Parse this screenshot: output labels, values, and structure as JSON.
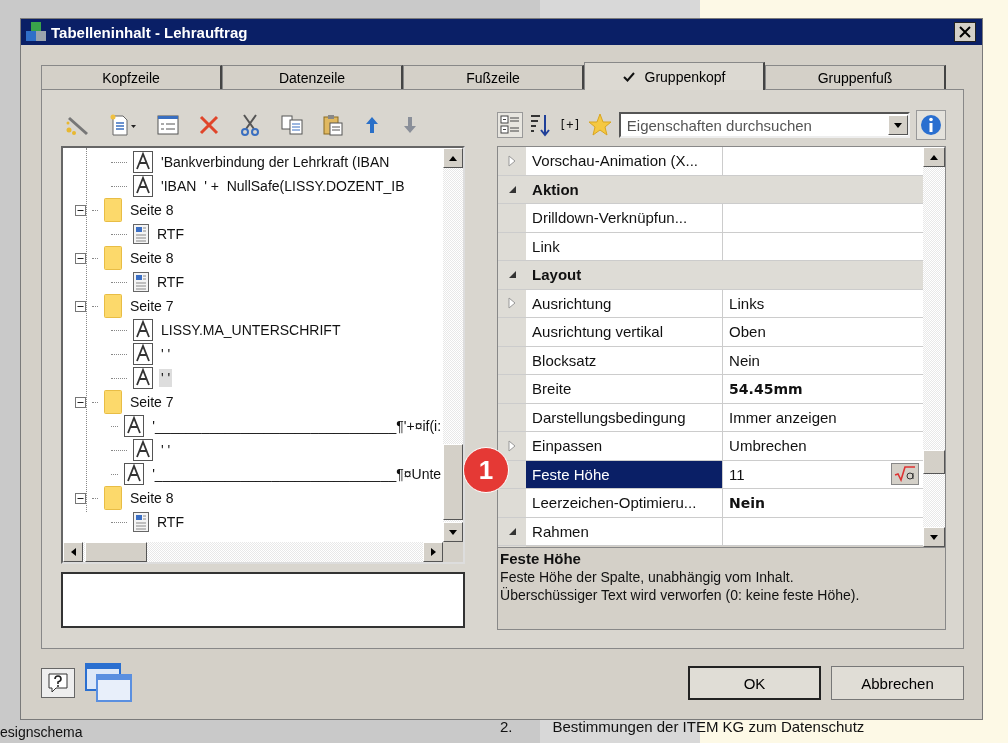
{
  "window": {
    "title": "Tabelleninhalt - Lehrauftrag"
  },
  "tabs": [
    {
      "label": "Kopfzeile",
      "selected": false,
      "checked": false
    },
    {
      "label": "Datenzeile",
      "selected": false,
      "checked": false
    },
    {
      "label": "Fußzeile",
      "selected": false,
      "checked": false
    },
    {
      "label": "Gruppenkopf",
      "selected": true,
      "checked": true
    },
    {
      "label": "Gruppenfuß",
      "selected": false,
      "checked": false
    }
  ],
  "tree": {
    "continued_children": [
      {
        "kind": "text",
        "label": "'Bankverbindung der Lehrkraft (IBAN",
        "selected": false
      },
      {
        "kind": "text",
        "label": "'IBAN  ' +  NullSafe(LISSY.DOZENT_IB",
        "selected": false
      }
    ],
    "nodes": [
      {
        "kind": "folder",
        "label": "Seite 8",
        "expanded": true,
        "children": [
          {
            "kind": "rtf",
            "label": "RTF",
            "selected": false
          }
        ]
      },
      {
        "kind": "folder",
        "label": "Seite 8",
        "expanded": true,
        "children": [
          {
            "kind": "rtf",
            "label": "RTF",
            "selected": false
          }
        ]
      },
      {
        "kind": "folder",
        "label": "Seite 7",
        "expanded": true,
        "children": [
          {
            "kind": "text",
            "label": "LISSY.MA_UNTERSCHRIFT",
            "selected": false
          },
          {
            "kind": "text",
            "label": "' '",
            "selected": false
          },
          {
            "kind": "text",
            "label": "' '",
            "selected": true
          }
        ]
      },
      {
        "kind": "folder",
        "label": "Seite 7",
        "expanded": true,
        "children": [
          {
            "kind": "text",
            "label": "'_______________________________¶'+¤if(i:",
            "selected": false
          },
          {
            "kind": "text",
            "label": "' '",
            "selected": false
          },
          {
            "kind": "text",
            "label": "'_______________________________¶¤Unte",
            "selected": false
          }
        ]
      },
      {
        "kind": "folder",
        "label": "Seite 8",
        "expanded": true,
        "children": [
          {
            "kind": "rtf",
            "label": "RTF",
            "selected": false
          }
        ]
      }
    ]
  },
  "property_toolbar": {
    "expand_all": "[+]",
    "search": {
      "placeholder": "Eigenschaften durchsuchen"
    }
  },
  "properties": [
    {
      "kind": "property",
      "name": "Vorschau-Animation (X...",
      "has_children": true,
      "expanded": false,
      "selected": false,
      "formula_button": false
    },
    {
      "kind": "category",
      "name": "Aktion",
      "expanded": true
    },
    {
      "kind": "property",
      "name": "Drilldown-Verknüpfun...",
      "has_children": false,
      "selected": false,
      "formula_button": false
    },
    {
      "kind": "property",
      "name": "Link",
      "has_children": false,
      "selected": false,
      "formula_button": false
    },
    {
      "kind": "category",
      "name": "Layout",
      "expanded": true
    },
    {
      "kind": "property",
      "name": "Ausrichtung",
      "value": "Links",
      "has_children": true,
      "expanded": false,
      "selected": false,
      "bold": false,
      "formula_button": false
    },
    {
      "kind": "property",
      "name": "Ausrichtung vertikal",
      "value": "Oben",
      "has_children": false,
      "selected": false,
      "bold": false,
      "formula_button": false
    },
    {
      "kind": "property",
      "name": "Blocksatz",
      "value": "Nein",
      "has_children": false,
      "selected": false,
      "bold": false,
      "formula_button": false
    },
    {
      "kind": "property",
      "name": "Breite",
      "value": "54.45mm",
      "has_children": false,
      "selected": false,
      "bold": true,
      "formula_button": false
    },
    {
      "kind": "property",
      "name": "Darstellungsbedingung",
      "value": "Immer anzeigen",
      "has_children": false,
      "selected": false,
      "bold": false,
      "formula_button": false
    },
    {
      "kind": "property",
      "name": "Einpassen",
      "value": "Umbrechen",
      "has_children": true,
      "expanded": false,
      "selected": false,
      "bold": false,
      "formula_button": false
    },
    {
      "kind": "property",
      "name": "Feste Höhe",
      "value": "11",
      "has_children": false,
      "selected": true,
      "bold": false,
      "formula_button": true
    },
    {
      "kind": "property",
      "name": "Leerzeichen-Optimieru...",
      "value": "Nein",
      "has_children": false,
      "selected": false,
      "bold": true,
      "formula_button": false
    },
    {
      "kind": "property",
      "name": "Rahmen",
      "has_children": true,
      "expanded": true,
      "selected": false,
      "formula_button": false
    }
  ],
  "description": {
    "title": "Feste Höhe",
    "lines": [
      "Feste Höhe der Spalte, unabhängig vom Inhalt.",
      "Überschüssiger Text wird verworfen (0: keine feste Höhe)."
    ]
  },
  "buttons": [
    {
      "label": "OK",
      "default": true
    },
    {
      "label": "Abbrechen",
      "default": false
    }
  ],
  "annotation": {
    "label": "1"
  },
  "background": {
    "list_number": "2.",
    "list_text": "Bestimmungen der ITEM KG zum Datenschutz",
    "left_text": "esignschema"
  }
}
